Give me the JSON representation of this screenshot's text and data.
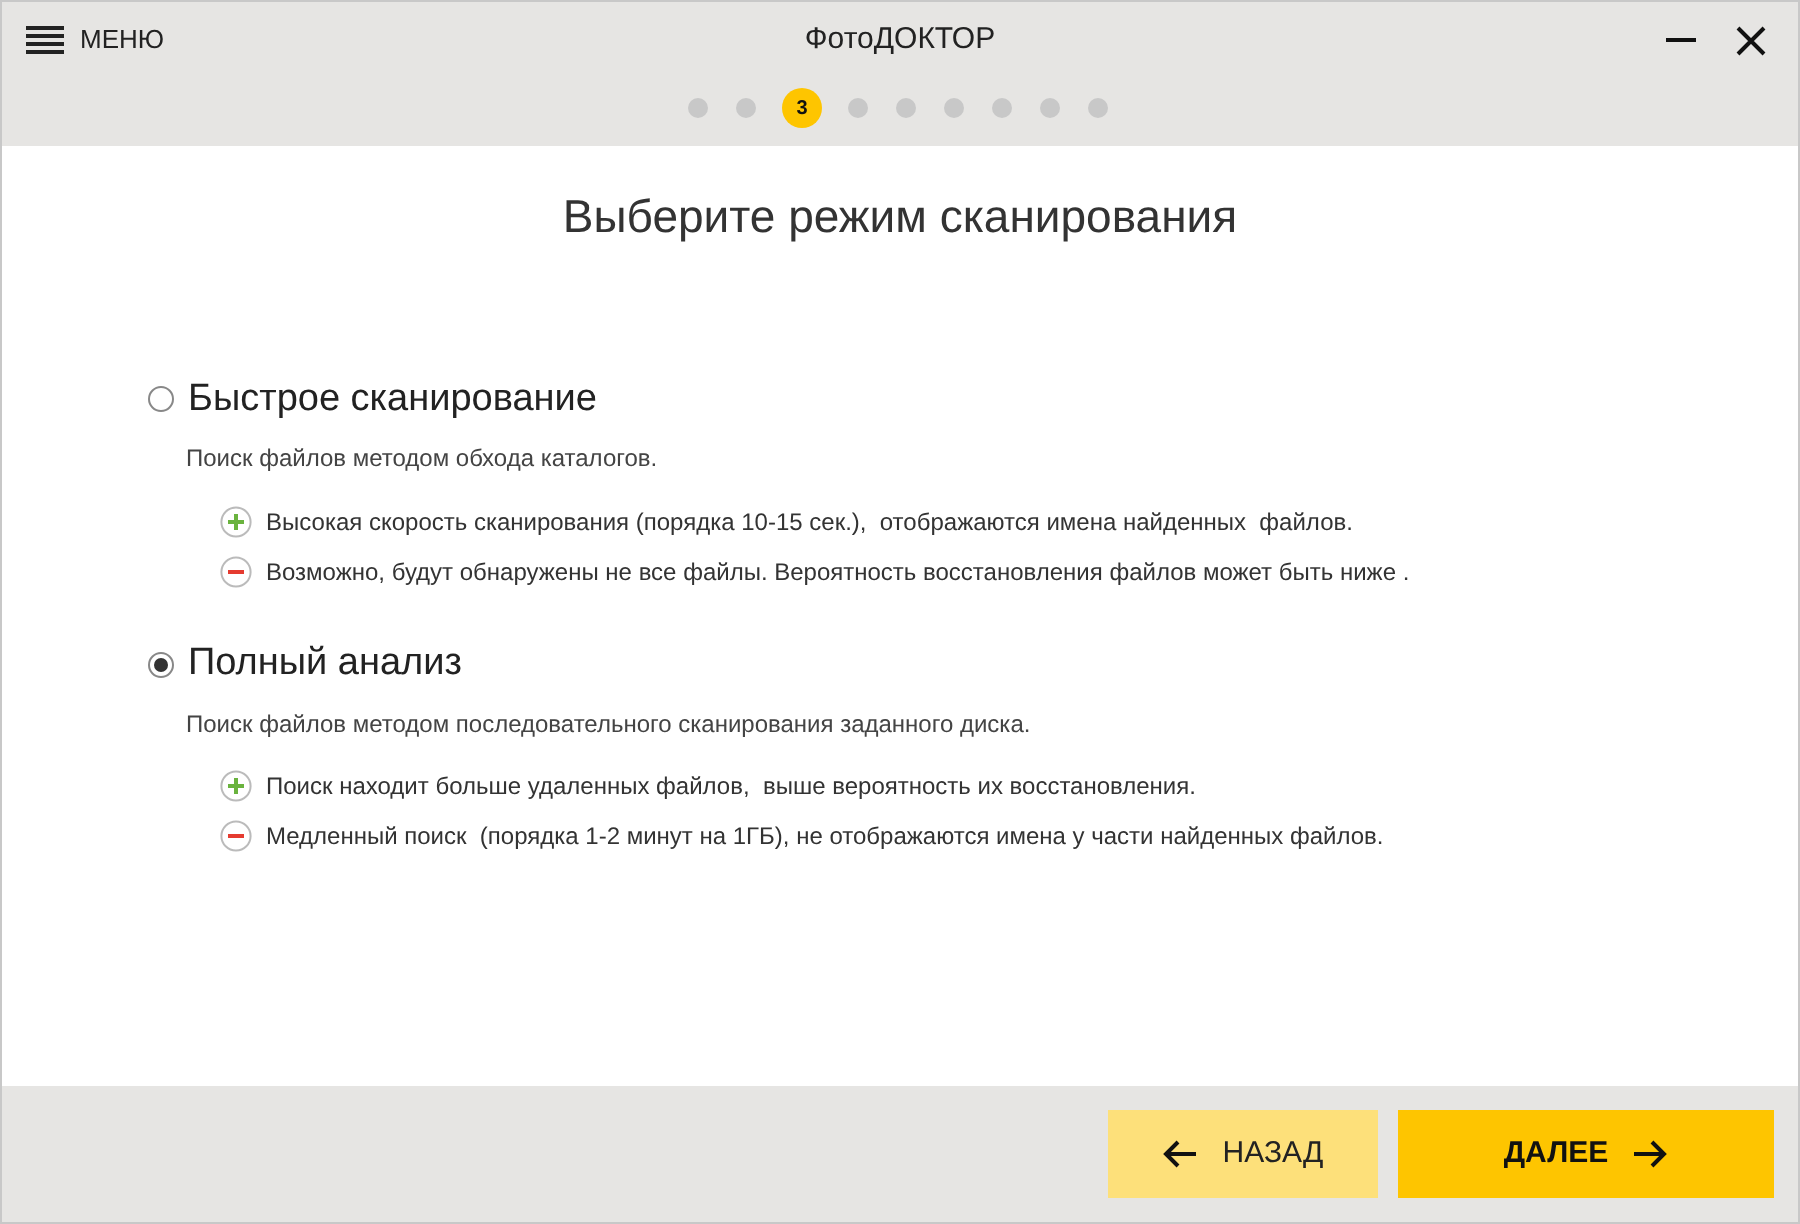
{
  "menu": {
    "label": "МЕНЮ"
  },
  "window": {
    "title": "ФотоДОКТОР"
  },
  "steps": [
    {
      "selected": false
    },
    {
      "selected": false
    },
    {
      "selected": true,
      "label": "3"
    },
    {
      "selected": false
    },
    {
      "selected": false
    },
    {
      "selected": false
    },
    {
      "selected": false
    },
    {
      "selected": false
    },
    {
      "selected": false
    }
  ],
  "heading": "Выберите режим сканирования",
  "options": [
    {
      "title": "Быстрое сканирование",
      "selected": false,
      "description": "Поиск файлов методом обхода каталогов.",
      "points": [
        {
          "kind": "pro",
          "text": "Высокая скорость сканирования (порядка 10-15 сек.),  отображаются имена найденных  файлов."
        },
        {
          "kind": "con",
          "text": "Возможно, будут обнаружены не все файлы. Вероятность восстановления файлов может быть ниже ."
        }
      ]
    },
    {
      "title": "Полный анализ",
      "selected": true,
      "description": "Поиск файлов методом последовательного сканирования заданного диска.",
      "points": [
        {
          "kind": "pro",
          "text": "Поиск находит больше удаленных файлов,  выше вероятность их восстановления."
        },
        {
          "kind": "con",
          "text": "Медленный поиск  (порядка 1-2 минут на 1ГБ), не отображаются имена у части найденных файлов."
        }
      ]
    }
  ],
  "buttons": {
    "back": "НАЗАД",
    "next": "ДАЛЕЕ"
  }
}
